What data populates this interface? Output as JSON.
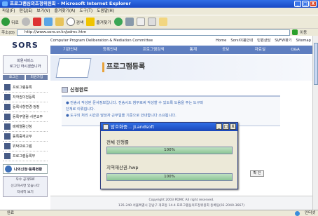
{
  "window": {
    "title": "프로그램심의조정위원회 - Microsoft Internet Explorer",
    "controls": [
      "_",
      "□",
      "X"
    ]
  },
  "menubar": [
    "파일(F)",
    "편집(E)",
    "보기(V)",
    "즐겨찾기(A)",
    "도구(T)",
    "도움말(H)"
  ],
  "toolbar": {
    "back": "뒤로",
    "search": "검색",
    "favorites": "즐겨찾기"
  },
  "address": {
    "label": "주소(D)",
    "url": "http://www.sors.or.kr/pdmc.htm",
    "go": "이동"
  },
  "site": {
    "logo": "SORS",
    "subtitle": "Computer Program Deliberation & Mediation Committee",
    "top_links": [
      "Home",
      "Sorsl이용안내",
      "민원상담",
      "SI/FW찾기",
      "Sitemap"
    ],
    "main_nav": [
      "기관안내",
      "등록안내",
      "프로그램검색",
      "통계",
      "공보",
      "자료실",
      "Q&A"
    ]
  },
  "sidebar": {
    "login_lines": [
      "회원서비스",
      "로그인 하시겠습니까"
    ],
    "login_buttons": [
      "로그인",
      "회원가입"
    ],
    "items": [
      "프로그램등록",
      "저작권이전등록",
      "등록사항변경·정정",
      "등록부열람·사본교부",
      "매체열람신청",
      "등록증재교부",
      "위탁프로그램",
      "프로그램등록부"
    ],
    "banner": "나의신청·등록현황",
    "ad_lines": [
      "우수 공개SW",
      "신고하시면 있습니다",
      "자세히 보기"
    ]
  },
  "banner": {
    "title": "프로그램등록"
  },
  "main": {
    "section_title": "신청완료",
    "notice": [
      "● 전송시 작성된 문서정보입니다. 전송시도 첨부로써 작성할 수 있도록 도움을 주는 도구와",
      "   단계로 이뤄집니다.",
      "● 도구의 처리 시간은 담당자 근무일을 기준으로 안내합니다 소요됩니다."
    ],
    "confirm_button": "확 인"
  },
  "dialog": {
    "title": "암호화중... JLandsoft",
    "controls": [
      "_",
      "□",
      "X"
    ],
    "total_label": "전체 진행률",
    "total_percent": "100%",
    "total_progress": 1.0,
    "file_label": "지역재산권.hwp",
    "file_percent": "100%",
    "file_progress": 1.0
  },
  "footer": {
    "line1": "Copyright 2003 PDMC All right reserved.",
    "line2": "135-240 서울특별시 강남구 개포동 14-4 프로그램심의조정위원회 등록팀(02-2040-3667)"
  },
  "status": {
    "left": "완료",
    "zone": "인터넷"
  },
  "colors": {
    "title_blue": "#1848c4",
    "nav_blue": "#5e7ec0",
    "progress_green": "#8cc596",
    "notice_blue": "#3a66b3"
  }
}
